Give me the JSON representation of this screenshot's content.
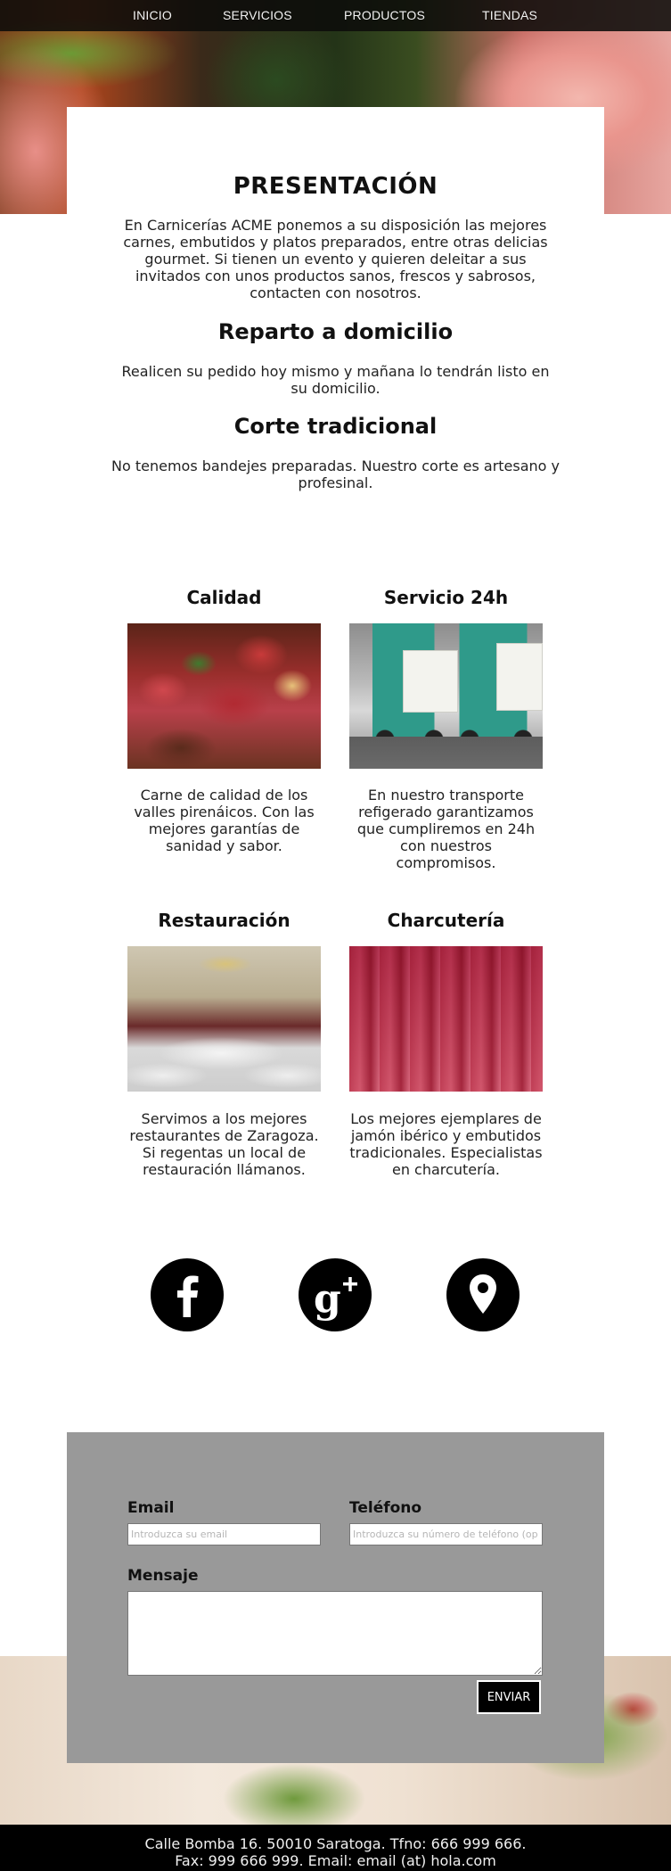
{
  "nav": {
    "items": [
      {
        "label": "INICIO"
      },
      {
        "label": "SERVICIOS"
      },
      {
        "label": "PRODUCTOS"
      },
      {
        "label": "TIENDAS"
      }
    ]
  },
  "intro": {
    "title": "PRESENTACIÓN",
    "text": "En Carnicerías ACME ponemos a su disposición las mejores carnes, embutidos y platos preparados, entre otras delicias gourmet. Si tienen un evento y quieren deleitar a sus invitados con unos productos sanos, frescos y sabrosos, contacten con nosotros.",
    "delivery_title": "Reparto a domicilio",
    "delivery_text": "Realicen su pedido hoy mismo y mañana lo tendrán listo en su domicilio.",
    "cut_title": "Corte tradicional",
    "cut_text": "No tenemos bandejes preparadas. Nuestro corte es artesano y profesinal."
  },
  "features": [
    {
      "title": "Calidad",
      "text": "Carne de calidad de los valles pirenáicos. Con las mejores garantías de sanidad y sabor.",
      "image": "meat-photo"
    },
    {
      "title": "Servicio 24h",
      "text": "En nuestro transporte refigerado garantizamos que cumpliremos en 24h con nuestros compromisos.",
      "image": "trucks-photo"
    },
    {
      "title": "Restauración",
      "text": "Servimos a los mejores restaurantes de Zaragoza. Si regentas un local de restauración llámanos.",
      "image": "restaurant-photo"
    },
    {
      "title": "Charcutería",
      "text": "Los mejores ejemplares de jamón ibérico y embutidos tradicionales. Especialistas en charcutería.",
      "image": "charcuterie-photo"
    }
  ],
  "social": [
    {
      "icon": "facebook-icon"
    },
    {
      "icon": "google-plus-icon"
    },
    {
      "icon": "location-pin-icon"
    }
  ],
  "form": {
    "email_label": "Email",
    "email_placeholder": "Introduzca su email",
    "email_value": "",
    "phone_label": "Teléfono",
    "phone_placeholder": "Introduzca su número de teléfono (op",
    "phone_value": "",
    "message_label": "Mensaje",
    "message_value": "",
    "send_label": "ENVIAR"
  },
  "footer": {
    "line1": "Calle Bomba 16. 50010 Saratoga. Tfno: 666 999 666.",
    "line2": "Fax: 999 666 999. Email: email (at) hola.com"
  },
  "colors": {
    "nav_bg": "#0c0c0a",
    "form_bg": "#999999",
    "footer_bg": "#000000",
    "social_bg": "#000000"
  }
}
